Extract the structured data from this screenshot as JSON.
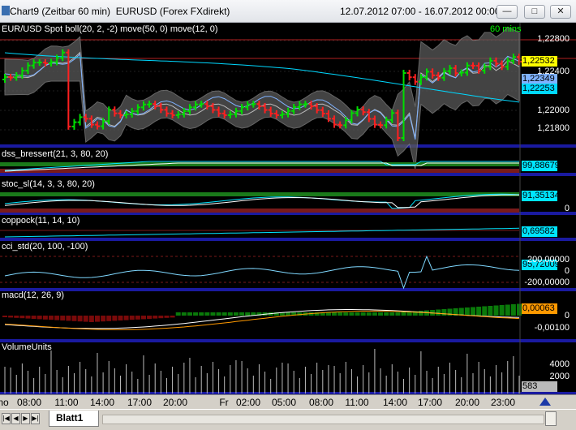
{
  "window": {
    "title": "Chart9 (Zeitbar 60 min)  EURUSD (Forex FXdirekt)",
    "range": "12.07.2012 07:00 - 16.07.2012 00:00",
    "min_label": "—",
    "max_label": "□",
    "close_label": "✕"
  },
  "price_panel": {
    "label": "EUR/USD Spot boll(20, 2, -2) move(50, 0) move(12, 0)",
    "period": "60 mins",
    "axis": [
      "1,22800",
      "1,22400",
      "1,22000",
      "1,21800"
    ],
    "value_boxes": [
      {
        "text": "1,22532",
        "color": "#ffff00"
      },
      {
        "text": "1,22349",
        "color": "#7fb2ff"
      },
      {
        "text": "1,22253",
        "color": "#00d8ff"
      }
    ]
  },
  "indicators": [
    {
      "key": "dss",
      "label": "dss_bressert(21, 3, 80, 20)",
      "value": "99,88679",
      "value_color": "#00e5ff",
      "axis": []
    },
    {
      "key": "stoc",
      "label": "stoc_sl(14, 3, 3, 80, 20)",
      "value": "91,35134",
      "value_color": "#00e5ff",
      "axis": [
        "0"
      ]
    },
    {
      "key": "coppock",
      "label": "coppock(11, 14, 10)",
      "value": "0,69582",
      "value_color": "#00e5ff",
      "axis": []
    },
    {
      "key": "cci",
      "label": "cci_std(20, 100, -100)",
      "value": "95,72009",
      "value_color": "#00e5ff",
      "axis": [
        "200,00000",
        "0",
        "-200,00000"
      ]
    },
    {
      "key": "macd",
      "label": "macd(12, 26, 9)",
      "value": "0,00063",
      "value_color": "#ff9900",
      "axis": [
        "0",
        "-0,00100"
      ]
    },
    {
      "key": "volume",
      "label": "VolumeUnits",
      "value": "583",
      "value_color": "#bbbbbb",
      "axis": [
        "4000",
        "2000"
      ]
    }
  ],
  "time_axis": [
    "no",
    "08:00",
    "11:00",
    "14:00",
    "17:00",
    "20:00",
    "Fr",
    "02:00",
    "05:00",
    "08:00",
    "11:00",
    "14:00",
    "17:00",
    "20:00",
    "23:00"
  ],
  "colors": {
    "up": "#00dd00",
    "down": "#ff2020",
    "band_fill": "#5a5a5a",
    "panel_bg": "#000000",
    "separator": "#1a1aa0"
  },
  "tabs": {
    "active": "Blatt1"
  },
  "nav": [
    "|◀",
    "◀",
    "▶",
    "▶|"
  ],
  "icons": {
    "corner": "chart-shape-icon"
  }
}
